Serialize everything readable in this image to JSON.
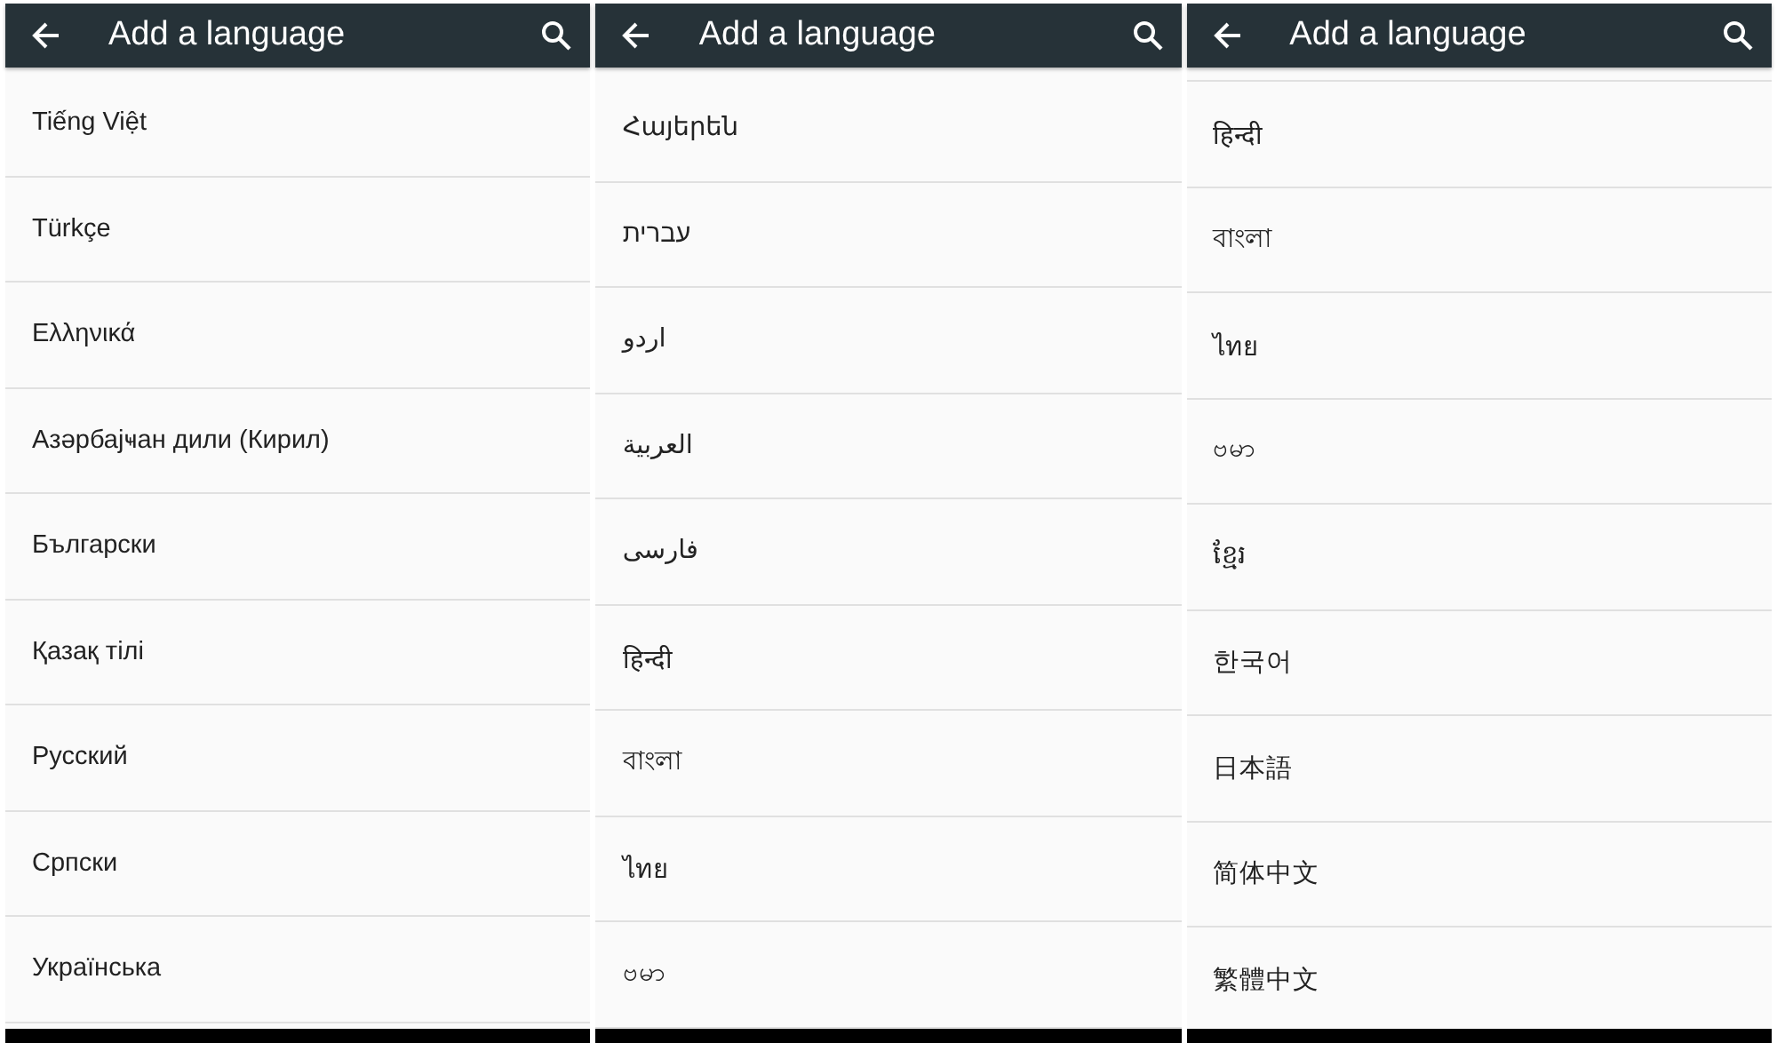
{
  "screens": [
    {
      "toolbar": {
        "title": "Add a language"
      },
      "items": [
        "Tiếng Việt",
        "Türkçe",
        "Ελληνικά",
        "Азәрбајҹан дили (Кирил)",
        "Български",
        "Қазақ тілі",
        "Русский",
        "Српски",
        "Українська"
      ]
    },
    {
      "toolbar": {
        "title": "Add a language"
      },
      "items": [
        "Հայերեն",
        "עברית",
        "اردو",
        "العربية",
        "فارسی",
        "हिन्दी",
        "বাংলা",
        "ไทย",
        "ဗမာ"
      ]
    },
    {
      "toolbar": {
        "title": "Add a language"
      },
      "items": [
        "हिन्दी",
        "বাংলা",
        "ไทย",
        "ဗမာ",
        "ខ្មែរ",
        "한국어",
        "日本語",
        "简体中文",
        "繁體中文"
      ]
    }
  ]
}
